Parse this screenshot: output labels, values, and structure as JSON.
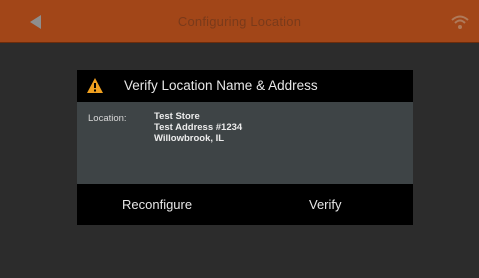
{
  "header": {
    "title": "Configuring Location",
    "back_icon": "back-arrow-icon",
    "status_icon": "wifi-icon",
    "bar_color": "#a24618"
  },
  "dialog": {
    "title": "Verify Location Name & Address",
    "warning_icon": "warning-icon",
    "warning_color": "#f0a020",
    "location_label": "Location:",
    "location_lines": [
      "Test Store",
      "Test Address #1234",
      "Willowbrook, IL"
    ],
    "buttons": {
      "reconfigure": "Reconfigure",
      "verify": "Verify"
    }
  }
}
